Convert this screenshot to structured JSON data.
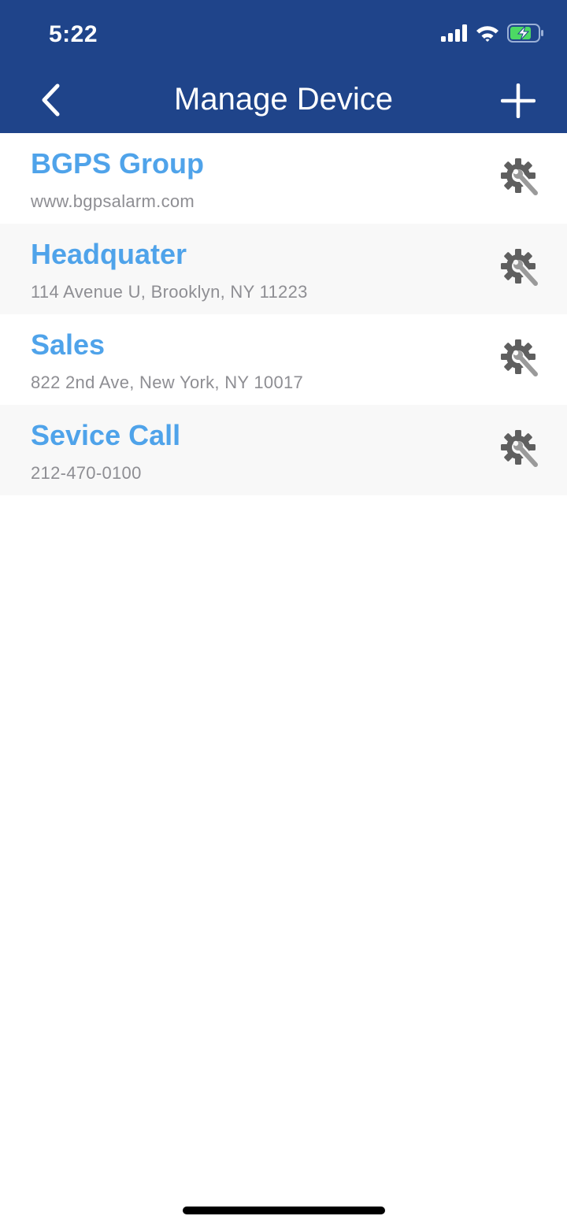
{
  "status_bar": {
    "time": "5:22",
    "icons": [
      "cellular-signal-icon",
      "wifi-icon",
      "battery-charging-icon"
    ]
  },
  "nav": {
    "title": "Manage Device",
    "back_icon": "chevron-left-icon",
    "add_icon": "plus-icon"
  },
  "colors": {
    "header_bg": "#1f448a",
    "device_name": "#4fa3ea",
    "detail_text": "#8e8e93",
    "row_alt_bg": "#f8f8f8",
    "settings_icon": "#5f5f5f"
  },
  "devices": [
    {
      "name": "BGPS Group",
      "detail": "www.bgpsalarm.com",
      "action_icon": "gear-wrench-icon"
    },
    {
      "name": "Headquater",
      "detail": "114 Avenue U, Brooklyn, NY 11223",
      "action_icon": "gear-wrench-icon"
    },
    {
      "name": "Sales",
      "detail": "822 2nd Ave, New York, NY 10017",
      "action_icon": "gear-wrench-icon"
    },
    {
      "name": "Sevice Call",
      "detail": "212-470-0100",
      "action_icon": "gear-wrench-icon"
    }
  ]
}
